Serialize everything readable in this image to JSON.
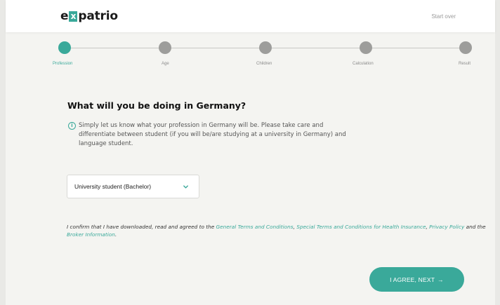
{
  "header": {
    "logo_pre": "e",
    "logo_x": "x",
    "logo_post": "patrio",
    "start_over": "Start over"
  },
  "steps": [
    {
      "label": "Profession",
      "active": true
    },
    {
      "label": "Age",
      "active": false
    },
    {
      "label": "Children",
      "active": false
    },
    {
      "label": "Calculation",
      "active": false
    },
    {
      "label": "Result",
      "active": false
    }
  ],
  "main": {
    "question": "What will you be doing in Germany?",
    "info_icon_glyph": "i",
    "info_text": "Simply let us know what your profession in Germany will be. Please take care and differentiate between student (if you will be/are studying at a university in Germany) and language student.",
    "select_value": "University student (Bachelor)"
  },
  "terms": {
    "prefix": "I confirm that I have downloaded, read and agreed to the ",
    "link_general": "General Terms and Conditions",
    "sep1": ", ",
    "link_special": "Special Terms and Conditions for Health Insurance",
    "sep2": ", ",
    "link_privacy": "Privacy Policy",
    "and_the": " and the ",
    "link_broker": "Broker Information",
    "suffix": "."
  },
  "cta": {
    "label": "I AGREE, NEXT",
    "arrow": "→"
  },
  "colors": {
    "accent": "#3aa99a",
    "inactive_dot": "#9d9d9b"
  }
}
